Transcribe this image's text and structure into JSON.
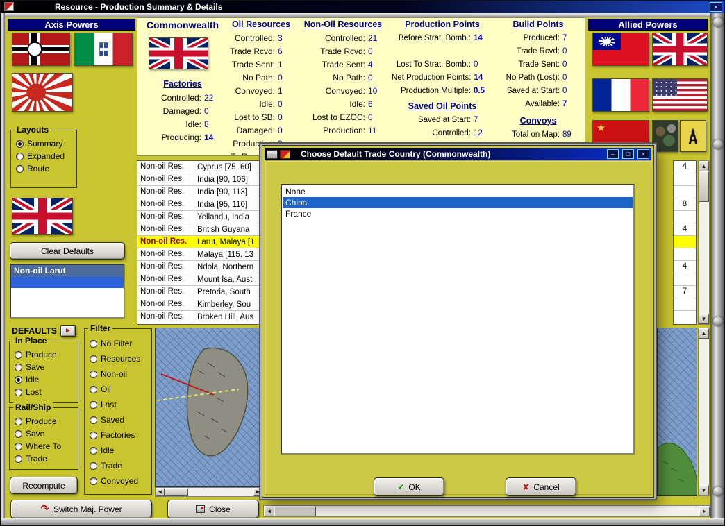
{
  "window": {
    "title": "Resource - Production Summary & Details"
  },
  "icons": {
    "window-close": "×",
    "window-min": "–",
    "window-max": "□",
    "scroll-up": "▲",
    "scroll-down": "▼",
    "scroll-left": "◄",
    "scroll-right": "►",
    "defaults-arrow": "►",
    "switch-power": "↷",
    "ok-check": "✔",
    "cancel-x": "✘"
  },
  "axis": {
    "title": "Axis Powers",
    "flags": [
      "germany-war-flag",
      "italy-flag",
      "japan-naval-ensign",
      "uk-flag"
    ],
    "layouts": {
      "title": "Layouts",
      "options": [
        {
          "label": "Summary",
          "selected": true
        },
        {
          "label": "Expanded",
          "selected": false
        },
        {
          "label": "Route",
          "selected": false
        }
      ]
    },
    "clear_defaults_label": "Clear Defaults",
    "defaults_list_header": "Non-oil Larut",
    "defaults_label": "DEFAULTS",
    "in_place": {
      "title": "In Place",
      "options": [
        {
          "label": "Produce",
          "selected": false
        },
        {
          "label": "Save",
          "selected": false
        },
        {
          "label": "Idle",
          "selected": true
        },
        {
          "label": "Lost",
          "selected": false
        }
      ]
    },
    "rail_ship": {
      "title": "Rail/Ship",
      "options": [
        {
          "label": "Produce",
          "selected": false
        },
        {
          "label": "Save",
          "selected": false
        },
        {
          "label": "Where To",
          "selected": false
        },
        {
          "label": "Trade",
          "selected": false
        }
      ]
    },
    "recompute_label": "Recompute"
  },
  "filter": {
    "title": "Filter",
    "options": [
      "No Filter",
      "Resources",
      "Non-oil",
      "Oil",
      "Lost",
      "Saved",
      "Factories",
      "Idle",
      "Trade",
      "Convoyed"
    ]
  },
  "allied": {
    "title": "Allied Powers",
    "flags": [
      "china-roc-flag",
      "uk-flag",
      "france-flag",
      "usa-flag",
      "ussr-flag"
    ],
    "tiles": [
      "terrain-tile-icon",
      "oil-derrick-icon"
    ]
  },
  "stats": {
    "country": "Commonwealth",
    "factories": {
      "title": "Factories",
      "rows": [
        {
          "label": "Controlled:",
          "value": "22"
        },
        {
          "label": "Damaged:",
          "value": "0"
        },
        {
          "label": "Idle:",
          "value": "8"
        },
        {
          "label": "Producing:",
          "value": "14",
          "bold": true
        }
      ]
    },
    "oil": {
      "title": "Oil Resources",
      "rows": [
        {
          "label": "Controlled:",
          "value": "3"
        },
        {
          "label": "Trade Rcvd:",
          "value": "6"
        },
        {
          "label": "Trade Sent:",
          "value": "1"
        },
        {
          "label": "No Path:",
          "value": "0"
        },
        {
          "label": "Convoyed:",
          "value": "1"
        },
        {
          "label": "Idle:",
          "value": "0"
        },
        {
          "label": "Lost to SB:",
          "value": "0"
        },
        {
          "label": "Damaged:",
          "value": "0"
        },
        {
          "label": "Production:",
          "value": "3"
        },
        {
          "label": "To Reorg. U",
          "value": ""
        }
      ]
    },
    "nonoil": {
      "title": "Non-Oil Resources",
      "rows": [
        {
          "label": "Controlled:",
          "value": "21"
        },
        {
          "label": "Trade Rcvd:",
          "value": "0"
        },
        {
          "label": "Trade Sent:",
          "value": "4"
        },
        {
          "label": "No Path:",
          "value": "0"
        },
        {
          "label": "Convoyed:",
          "value": "10"
        },
        {
          "label": "Idle:",
          "value": "6"
        },
        {
          "label": "Lost to EZOC:",
          "value": "0"
        },
        {
          "label": "Production:",
          "value": "11"
        }
      ],
      "footer": "Total Resources"
    },
    "production": {
      "title": "Production Points",
      "rows": [
        {
          "label": "Before Strat. Bomb.:",
          "value": "14",
          "bold": true
        },
        {
          "label": "",
          "value": ""
        },
        {
          "label": "Lost To Strat. Bomb.:",
          "value": "0"
        },
        {
          "label": "Net Production Points:",
          "value": "14",
          "bold": true
        },
        {
          "label": "Production Multiple:",
          "value": "0.5",
          "bold": true
        }
      ],
      "subtitle": "Saved Oil Points",
      "rows2": [
        {
          "label": "Saved at Start:",
          "value": "7"
        },
        {
          "label": "Controlled:",
          "value": "12"
        }
      ]
    },
    "build": {
      "title": "Build Points",
      "rows": [
        {
          "label": "Produced:",
          "value": "7"
        },
        {
          "label": "Trade Rcvd:",
          "value": "0"
        },
        {
          "label": "Trade Sent:",
          "value": "0"
        },
        {
          "label": "No Path (Lost):",
          "value": "0"
        },
        {
          "label": "Saved at Start:",
          "value": "0"
        },
        {
          "label": "Available:",
          "value": "7",
          "bold": true
        }
      ],
      "subtitle": "Convoys",
      "rows2": [
        {
          "label": "Total on Map:",
          "value": "89"
        }
      ]
    }
  },
  "resource_table": {
    "rows": [
      {
        "type": "Non-oil Res.",
        "name": "Cyprus [75, 60]",
        "right": "4"
      },
      {
        "type": "Non-oil Res.",
        "name": "India [90, 106]",
        "right": ""
      },
      {
        "type": "Non-oil Res.",
        "name": "India [90, 113]",
        "right": ""
      },
      {
        "type": "Non-oil Res.",
        "name": "India [95, 110]",
        "right": "8"
      },
      {
        "type": "Non-oil Res.",
        "name": "Yellandu, India",
        "right": ""
      },
      {
        "type": "Non-oil Res.",
        "name": "British Guyana",
        "right": "4"
      },
      {
        "type": "Non-oil Res.",
        "name": "Larut, Malaya [1",
        "right": "",
        "highlight": true
      },
      {
        "type": "Non-oil Res.",
        "name": "Malaya [115, 13",
        "right": ""
      },
      {
        "type": "Non-oil Res.",
        "name": "Ndola, Northern",
        "right": "4"
      },
      {
        "type": "Non-oil Res.",
        "name": "Mount Isa, Aust",
        "right": ""
      },
      {
        "type": "Non-oil Res.",
        "name": "Pretoria, South",
        "right": "7"
      },
      {
        "type": "Non-oil Res.",
        "name": "Kimberley, Sou",
        "right": ""
      },
      {
        "type": "Non-oil Res.",
        "name": "Broken Hill, Aus",
        "right": ""
      }
    ]
  },
  "dialog": {
    "title": "Choose Default Trade Country (Commonwealth)",
    "items": [
      {
        "label": "None",
        "selected": false
      },
      {
        "label": "China",
        "selected": true
      },
      {
        "label": "France",
        "selected": false
      }
    ],
    "ok_label": "OK",
    "cancel_label": "Cancel"
  },
  "footer": {
    "switch_power_label": "Switch Maj. Power",
    "close_label": "Close"
  },
  "colors": {
    "value_blue": "#0000CD",
    "header_navy": "#00008B",
    "panel_header_blue": "#00007B",
    "selection_blue": "#1E64C8",
    "highlight_yellow": "#FFFF00",
    "background_khaki": "#C9C52F",
    "stats_panel_yellow": "#FFFFC6"
  }
}
